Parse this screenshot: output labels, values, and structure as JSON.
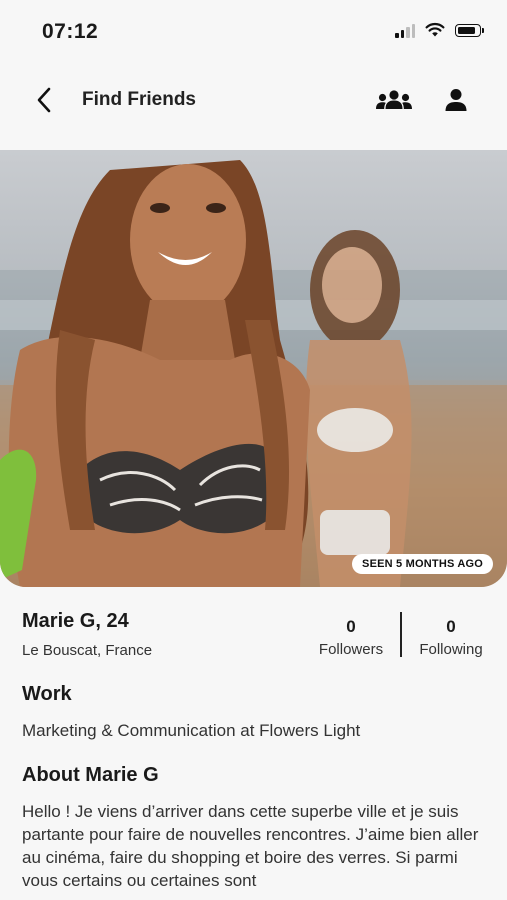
{
  "status_bar": {
    "time": "07:12",
    "battery_level": 0.7
  },
  "nav": {
    "title": "Find Friends",
    "back_icon": "chevron-left-icon",
    "group_icon": "group-icon",
    "user_icon": "user-icon"
  },
  "photo": {
    "seen_label": "SEEN 5 MONTHS AGO"
  },
  "profile": {
    "name_age": "Marie G, 24",
    "location": "Le Bouscat, France",
    "followers_count": "0",
    "followers_label": "Followers",
    "following_count": "0",
    "following_label": "Following"
  },
  "work": {
    "title": "Work",
    "text": "Marketing & Communication at Flowers Light"
  },
  "about": {
    "title": "About Marie G",
    "text": "Hello ! Je viens d’arriver dans cette superbe ville et je suis partante pour faire de nouvelles rencontres. J’aime bien aller au cinéma, faire du shopping et boire des verres. Si parmi vous certains ou certaines sont"
  }
}
